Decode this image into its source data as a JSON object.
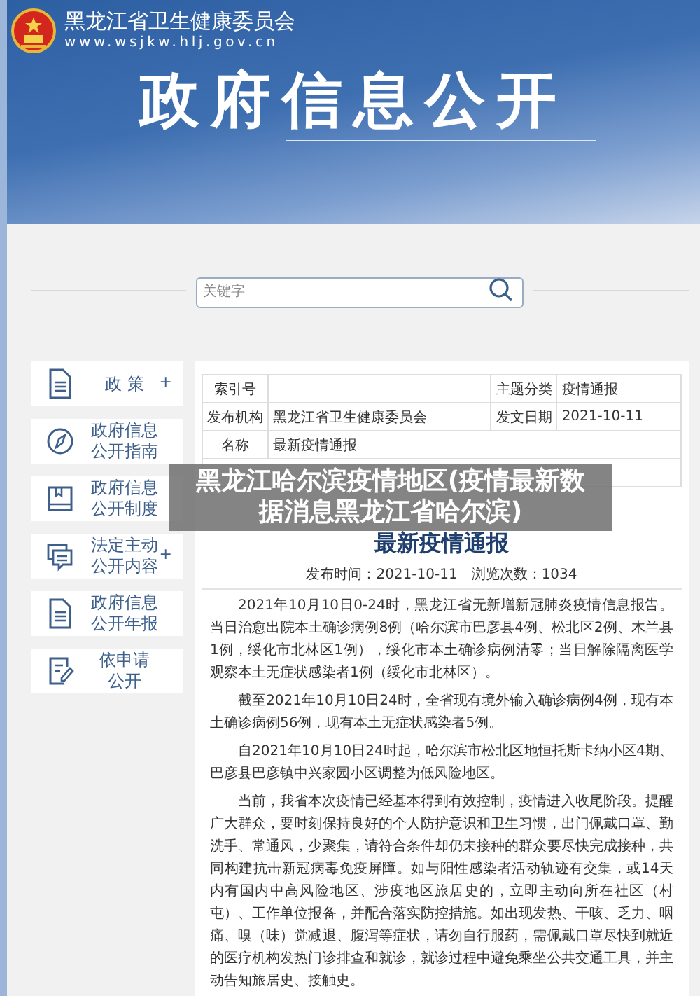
{
  "header": {
    "site_name": "黑龙江省卫生健康委员会",
    "site_url": "www.wsjkw.hlj.gov.cn",
    "banner_title": "政府信息公开"
  },
  "search": {
    "placeholder": "关键字"
  },
  "sidebar": {
    "items": [
      {
        "lines": [
          "政 策"
        ],
        "expand_mark": "+"
      },
      {
        "lines": [
          "政府信息",
          "公开指南"
        ]
      },
      {
        "lines": [
          "政府信息",
          "公开制度"
        ]
      },
      {
        "lines": [
          "法定主动",
          "公开内容"
        ],
        "expand_mark": "+"
      },
      {
        "lines": [
          "政府信息",
          "公开年报"
        ]
      },
      {
        "lines": [
          "依申请",
          "公开"
        ]
      }
    ]
  },
  "meta_table": {
    "rows": [
      {
        "cells": [
          {
            "label": "索引号"
          },
          {
            "label": "主题分类",
            "value": "疫情通报"
          }
        ]
      },
      {
        "cells": [
          {
            "label": "发布机构",
            "value": "黑龙江省卫生健康委员会"
          },
          {
            "label": "发文日期",
            "value": "2021-10-11"
          }
        ]
      },
      {
        "cells": [
          {
            "label": "名称",
            "value": "最新疫情通报"
          }
        ]
      },
      {
        "cells": []
      }
    ]
  },
  "article": {
    "title": "最新疫情通报",
    "publish_info": "发布时间：2021-10-11　浏览次数：1034",
    "paragraphs": [
      "2021年10月10日0-24时，黑龙江省无新增新冠肺炎疫情信息报告。当日治愈出院本土确诊病例8例（哈尔滨市巴彦县4例、松北区2例、木兰县1例，绥化市北林区1例），绥化市本土确诊病例清零；当日解除隔离医学观察本土无症状感染者1例（绥化市北林区）。",
      "截至2021年10月10日24时，全省现有境外输入确诊病例4例，现有本土确诊病例56例，现有本土无症状感染者5例。",
      "自2021年10月10日24时起，哈尔滨市松北区地恒托斯卡纳小区4期、巴彦县巴彦镇中兴家园小区调整为低风险地区。",
      "当前，我省本次疫情已经基本得到有效控制，疫情进入收尾阶段。提醒广大群众，要时刻保持良好的个人防护意识和卫生习惯，出门佩戴口罩、勤洗手、常通风，少聚集，请符合条件却仍未接种的群众要尽快完成接种，共同构建抗击新冠病毒免疫屏障。如与阳性感染者活动轨迹有交集，或14天内有国内中高风险地区、涉疫地区旅居史的，立即主动向所在社区（村屯）、工作单位报备，并配合落实防控措施。如出现发热、干咳、乏力、咽痛、嗅（味）觉减退、腹泻等症状，请勿自行服药，需佩戴口罩尽快到就近的医疗机构发热门诊排查和就诊，就诊过程中避免乘坐公共交通工具，并主动告知旅居史、接触史。"
    ]
  },
  "caption_overlay": {
    "lines": [
      "黑龙江哈尔滨疫情地区(疫情最新数",
      "据消息黑龙江省哈尔滨)"
    ]
  }
}
